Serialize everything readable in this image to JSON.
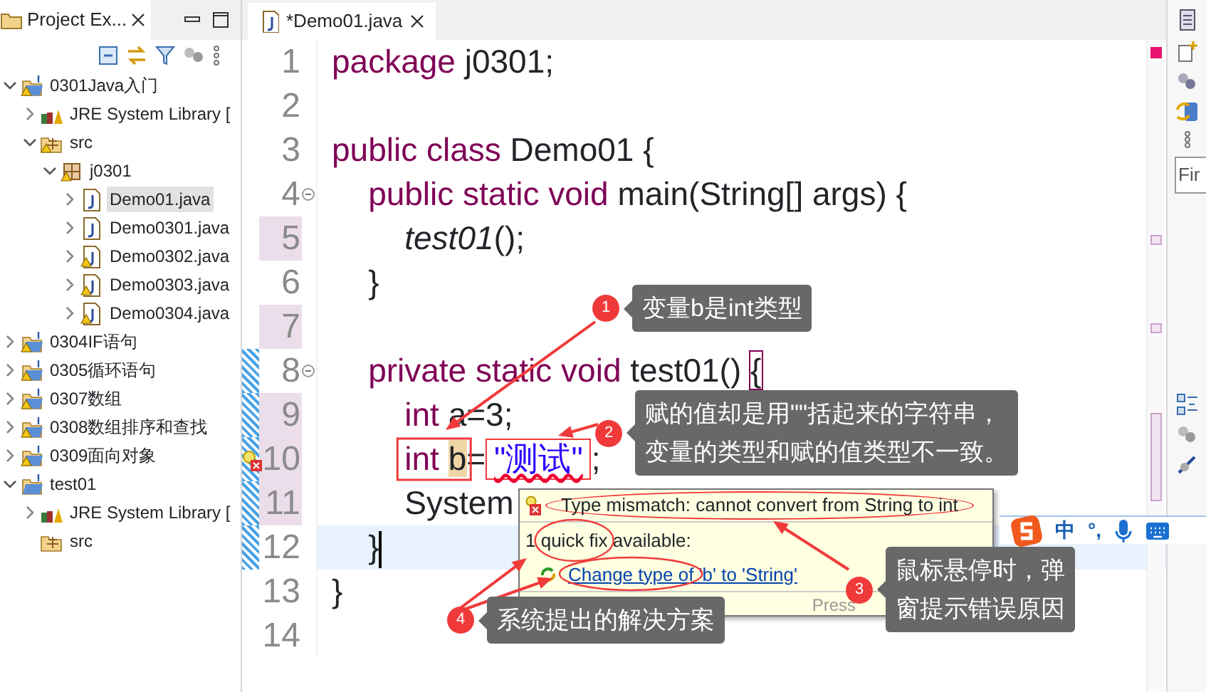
{
  "explorer": {
    "title": "Project Ex...",
    "tree": [
      {
        "label": "0301Java入门",
        "kind": "project",
        "warning": true,
        "expanded": true,
        "selected": false,
        "children": [
          {
            "label": "JRE System Library [",
            "kind": "library",
            "warning": false,
            "expanded": false,
            "selected": false
          },
          {
            "label": "src",
            "kind": "source-folder",
            "warning": true,
            "expanded": true,
            "selected": false,
            "children": [
              {
                "label": "j0301",
                "kind": "package",
                "warning": true,
                "expanded": true,
                "selected": false,
                "children": [
                  {
                    "label": "Demo01.java",
                    "kind": "java-file",
                    "warning": false,
                    "expanded": false,
                    "selected": true
                  },
                  {
                    "label": "Demo0301.java",
                    "kind": "java-file",
                    "warning": false,
                    "expanded": false,
                    "selected": false
                  },
                  {
                    "label": "Demo0302.java",
                    "kind": "java-file",
                    "warning": true,
                    "expanded": false,
                    "selected": false
                  },
                  {
                    "label": "Demo0303.java",
                    "kind": "java-file",
                    "warning": true,
                    "expanded": false,
                    "selected": false
                  },
                  {
                    "label": "Demo0304.java",
                    "kind": "java-file",
                    "warning": true,
                    "expanded": false,
                    "selected": false
                  }
                ]
              }
            ]
          }
        ]
      },
      {
        "label": "0304IF语句",
        "kind": "project",
        "warning": true,
        "expanded": false,
        "selected": false
      },
      {
        "label": "0305循环语句",
        "kind": "project",
        "warning": true,
        "expanded": false,
        "selected": false
      },
      {
        "label": "0307数组",
        "kind": "project",
        "warning": true,
        "expanded": false,
        "selected": false
      },
      {
        "label": "0308数组排序和查找",
        "kind": "project",
        "warning": true,
        "expanded": false,
        "selected": false
      },
      {
        "label": "0309面向对象",
        "kind": "project",
        "warning": true,
        "expanded": false,
        "selected": false
      },
      {
        "label": "test01",
        "kind": "project",
        "warning": false,
        "expanded": true,
        "selected": false,
        "children": [
          {
            "label": "JRE System Library [",
            "kind": "library",
            "warning": false,
            "expanded": false,
            "selected": false
          },
          {
            "label": "src",
            "kind": "source-folder",
            "warning": false,
            "selected": false
          }
        ]
      }
    ]
  },
  "editor": {
    "tab": "*Demo01.java",
    "lines": [
      {
        "number": "1",
        "modified": false,
        "marked": false,
        "current": false,
        "error": false,
        "foldable": false,
        "tokens": [
          {
            "kind": "keyword",
            "text": "package"
          },
          {
            "kind": "plain",
            "text": " j0301;"
          }
        ]
      },
      {
        "number": "2",
        "modified": false,
        "marked": false,
        "current": false,
        "error": false,
        "foldable": false
      },
      {
        "number": "3",
        "modified": false,
        "marked": false,
        "current": false,
        "error": false,
        "foldable": false,
        "tokens": [
          {
            "kind": "keyword",
            "text": "public class"
          },
          {
            "kind": "plain",
            "text": " Demo01 {"
          }
        ]
      },
      {
        "number": "4",
        "modified": false,
        "marked": false,
        "current": false,
        "error": false,
        "foldable": true,
        "tokens": [
          {
            "kind": "keyword",
            "text": "    public static void"
          },
          {
            "kind": "plain",
            "text": " main(String[] args) {"
          }
        ]
      },
      {
        "number": "5",
        "modified": true,
        "marked": false,
        "current": false,
        "error": false,
        "foldable": false,
        "tokens": [
          {
            "kind": "static-call",
            "text": "        test01"
          },
          {
            "kind": "plain",
            "text": "();"
          }
        ]
      },
      {
        "number": "6",
        "modified": false,
        "marked": false,
        "current": false,
        "error": false,
        "foldable": false,
        "tokens": [
          {
            "kind": "plain",
            "text": "    }"
          }
        ]
      },
      {
        "number": "7",
        "modified": true,
        "marked": false,
        "current": false,
        "error": false,
        "foldable": false
      },
      {
        "number": "8",
        "modified": false,
        "marked": true,
        "current": false,
        "error": false,
        "foldable": true,
        "tokens": [
          {
            "kind": "keyword",
            "text": "    private static void"
          },
          {
            "kind": "plain",
            "text": " test01() "
          },
          {
            "kind": "bracket-match",
            "text": "{"
          }
        ]
      },
      {
        "number": "9",
        "modified": true,
        "marked": true,
        "current": false,
        "error": false,
        "foldable": false,
        "tokens": [
          {
            "kind": "keyword",
            "text": "        int"
          },
          {
            "kind": "plain",
            "text": " a=3;"
          }
        ]
      },
      {
        "number": "10",
        "modified": true,
        "marked": true,
        "current": false,
        "error": true,
        "foldable": false,
        "tokens": [
          {
            "kind": "keyword",
            "text": "        int "
          },
          {
            "kind": "occurrence",
            "text": "b"
          },
          {
            "kind": "plain",
            "text": "="
          },
          {
            "kind": "string-error",
            "text": "\"测试\""
          },
          {
            "kind": "plain",
            "text": ";"
          }
        ]
      },
      {
        "number": "11",
        "modified": true,
        "marked": true,
        "current": false,
        "error": false,
        "foldable": false,
        "tokens": [
          {
            "kind": "plain",
            "text": "        System"
          }
        ]
      },
      {
        "number": "12",
        "modified": false,
        "marked": true,
        "current": true,
        "error": false,
        "foldable": false,
        "tokens": [
          {
            "kind": "plain",
            "text": "    }"
          }
        ]
      },
      {
        "number": "13",
        "modified": false,
        "marked": false,
        "current": false,
        "error": false,
        "foldable": false,
        "tokens": [
          {
            "kind": "plain",
            "text": "}"
          }
        ]
      },
      {
        "number": "14",
        "modified": false,
        "marked": false,
        "current": false,
        "error": false,
        "foldable": false
      }
    ]
  },
  "hover": {
    "problem": "Type mismatch: cannot convert from String to int",
    "fix_count": "1 quick fix available:",
    "fix": "Change type of 'b' to 'String'",
    "footer": "Press"
  },
  "right_panel": {
    "field_value": "Fir"
  },
  "ime_bar": {
    "mode": "中",
    "punctuation": "°,"
  },
  "callouts": [
    {
      "number": "1",
      "lines": [
        "变量b是int类型"
      ]
    },
    {
      "number": "2",
      "lines": [
        "赋的值却是用\"\"括起来的字符串，",
        "变量的类型和赋的值类型不一致。"
      ]
    },
    {
      "number": "3",
      "lines": [
        "鼠标悬停时，弹",
        "窗提示错误原因"
      ]
    },
    {
      "number": "4",
      "lines": [
        "系统提出的解决方案"
      ]
    }
  ]
}
